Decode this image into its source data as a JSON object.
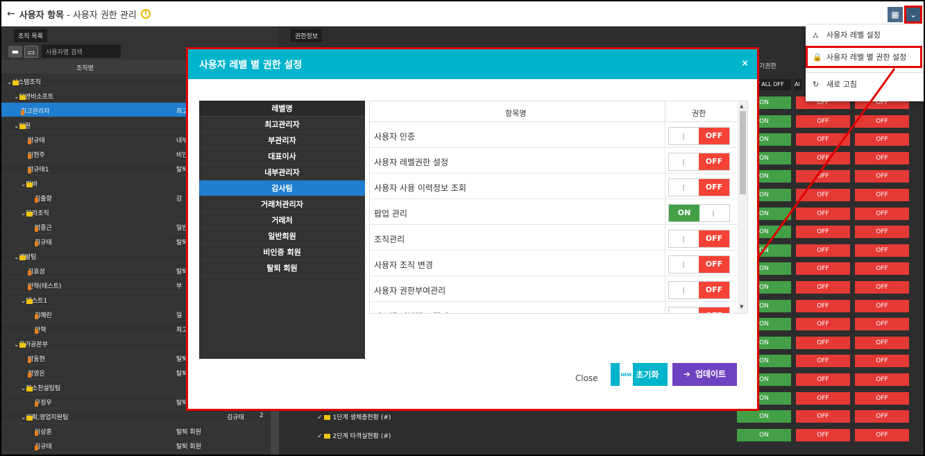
{
  "topbar": {
    "back_icon": "←",
    "title": "사용자 항목",
    "subtitle": "- 사용자 권한 관리",
    "warn": "!",
    "grid_icon": "▦",
    "dropdown_icon": "⌄"
  },
  "left": {
    "org_label": "조직 목록",
    "search_placeholder": "사용자명 검색",
    "col_name": "조직명",
    "rows": [
      {
        "label": "시스템조직",
        "type": "folder",
        "indent": 0,
        "mid": ""
      },
      {
        "label": "디앤비소프트",
        "type": "folder",
        "indent": 1,
        "mid": ""
      },
      {
        "label": "최고관리자",
        "type": "person",
        "indent": 2,
        "mid": "최고",
        "selected": true
      },
      {
        "label": "임원",
        "type": "folder",
        "indent": 1,
        "mid": ""
      },
      {
        "label": "박규태",
        "type": "person",
        "indent": 3,
        "mid": "내부"
      },
      {
        "label": "임현주",
        "type": "person",
        "indent": 3,
        "mid": "비인"
      },
      {
        "label": "박규태1",
        "type": "person",
        "indent": 3,
        "mid": "탈퇴"
      },
      {
        "label": "마바",
        "type": "folder",
        "indent": 2,
        "mid": ""
      },
      {
        "label": "김출향",
        "type": "person",
        "indent": 4,
        "mid": "감"
      },
      {
        "label": "다라조직",
        "type": "folder",
        "indent": 2,
        "mid": ""
      },
      {
        "label": "박종근",
        "type": "person",
        "indent": 4,
        "mid": "일반"
      },
      {
        "label": "최규태",
        "type": "person",
        "indent": 4,
        "mid": "탈퇴"
      },
      {
        "label": "개발팀",
        "type": "folder",
        "indent": 1,
        "mid": ""
      },
      {
        "label": "김효성",
        "type": "person",
        "indent": 3,
        "mid": "탈퇴"
      },
      {
        "label": "안혁(테스트)",
        "type": "person",
        "indent": 3,
        "mid": "부"
      },
      {
        "label": "테스트1",
        "type": "folder",
        "indent": 2,
        "mid": ""
      },
      {
        "label": "김예린",
        "type": "person",
        "indent": 4,
        "mid": "일"
      },
      {
        "label": "안혁",
        "type": "person",
        "indent": 4,
        "mid": "최고"
      },
      {
        "label": "육가공본부",
        "type": "folder",
        "indent": 1,
        "mid": ""
      },
      {
        "label": "박동현",
        "type": "person",
        "indent": 3,
        "mid": "탈퇴"
      },
      {
        "label": "정영은",
        "type": "person",
        "indent": 3,
        "mid": "탈퇴"
      },
      {
        "label": "본소천설팅팀",
        "type": "folder",
        "indent": 2,
        "mid": ""
      },
      {
        "label": "우정우",
        "type": "person",
        "indent": 4,
        "mid": "탈퇴"
      },
      {
        "label": "기획,영업지원팀",
        "type": "folder",
        "indent": 2,
        "mid": "김규태",
        "count": "2"
      },
      {
        "label": "이상훈",
        "type": "person",
        "indent": 4,
        "mid": "탈퇴 회원"
      },
      {
        "label": "김규태",
        "type": "person",
        "indent": 4,
        "mid": "탈퇴 회원"
      }
    ]
  },
  "right": {
    "perm_label": "권한정보",
    "col_partial": "기권한",
    "all_toggle": "/ ALL OFF",
    "all_toggle2": "Al",
    "on": "ON",
    "off": "OFF",
    "bottom_rows": [
      "1단계 생체증현황 (#)",
      "2단계 타격실현황 (#)"
    ]
  },
  "menu": {
    "items": [
      {
        "label": "사용자 레벨 설정",
        "icon": "⛼"
      },
      {
        "label": "사용자 레벨 별 권한 설정",
        "icon": "🔒"
      },
      {
        "label": "새로 고침",
        "icon": "↻"
      }
    ]
  },
  "modal": {
    "title": "사용자 레벨 별 권한 설정",
    "close_icon": "×",
    "level_header": "레벨명",
    "levels": [
      "최고관리자",
      "부관리자",
      "대표이사",
      "내부관리자",
      "감사팀",
      "거래처관리자",
      "거래처",
      "일반회원",
      "비인증 회원",
      "탈퇴 회원"
    ],
    "selected_level": "감사팀",
    "col_item": "항목명",
    "col_perm": "권한",
    "perms": [
      {
        "name": "사용자 인증",
        "state": "OFF"
      },
      {
        "name": "사용자 레벨권한 설정",
        "state": "OFF"
      },
      {
        "name": "사용자 사용 이력정보 조회",
        "state": "OFF"
      },
      {
        "name": "팝업 관리",
        "state": "ON"
      },
      {
        "name": "조직관리",
        "state": "OFF"
      },
      {
        "name": "사용자 조직 변경",
        "state": "OFF"
      },
      {
        "name": "사용자 권한부여관리",
        "state": "OFF"
      },
      {
        "name": "시스템 기본정보 관리",
        "state": "OFF"
      }
    ],
    "close_label": "Close",
    "reset_badge": "NEW",
    "reset_label": "초기화",
    "update_icon": "➔",
    "update_label": "업데이트"
  }
}
